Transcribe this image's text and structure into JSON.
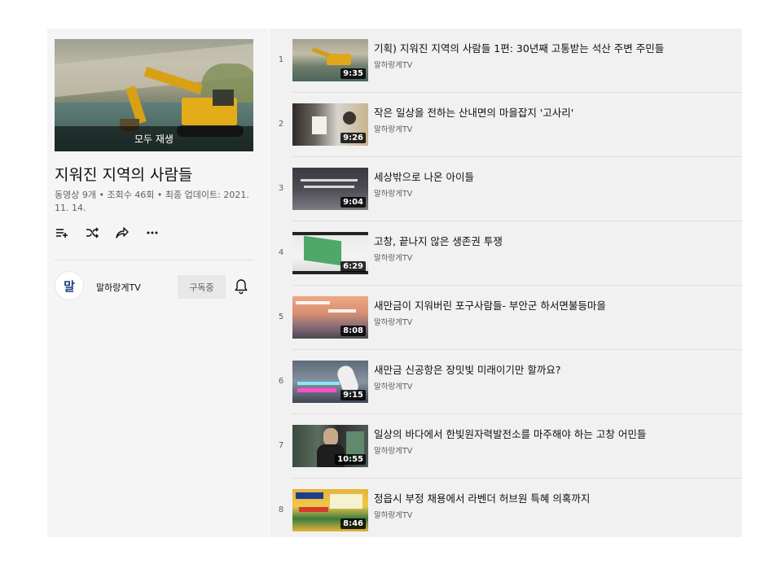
{
  "playlist": {
    "play_all_label": "모두 재생",
    "title": "지워진 지역의 사람들",
    "meta_line1": "동영상 9개 • 조회수 46회 • 최종 업데이트: 2021.",
    "meta_line2": "11. 14.",
    "owner": {
      "avatar_text": "말",
      "name": "말하랑게TV",
      "subscribe_label": "구독중"
    }
  },
  "icons": {
    "add_to_queue": "add-to-queue-icon",
    "shuffle": "shuffle-icon",
    "share": "share-icon",
    "more": "more-icon",
    "bell": "bell-icon"
  },
  "videos": [
    {
      "index": "1",
      "title": "기획) 지워진 지역의 사람들 1편: 30년째 고통받는 석산 주변 주민들",
      "channel": "말하랑게TV",
      "duration": "9:35"
    },
    {
      "index": "2",
      "title": "작은 일상을 전하는 산내면의 마을잡지 '고사리'",
      "channel": "말하랑게TV",
      "duration": "9:26"
    },
    {
      "index": "3",
      "title": "세상밖으로 나온 아이들",
      "channel": "말하랑게TV",
      "duration": "9:04"
    },
    {
      "index": "4",
      "title": "고창, 끝나지 않은 생존권 투쟁",
      "channel": "말하랑게TV",
      "duration": "6:29"
    },
    {
      "index": "5",
      "title": "새만금이 지워버린 포구사람들- 부안군 하서면불등마을",
      "channel": "말하랑게TV",
      "duration": "8:08"
    },
    {
      "index": "6",
      "title": "새만금 신공항은 장밋빛 미래이기만 할까요?",
      "channel": "말하랑게TV",
      "duration": "9:15"
    },
    {
      "index": "7",
      "title": "일상의 바다에서 한빛원자력발전소를 마주해야 하는 고창 어민들",
      "channel": "말하랑게TV",
      "duration": "10:55"
    },
    {
      "index": "8",
      "title": "정읍시 부정 채용에서 라벤더 허브원 특혜 의혹까지",
      "channel": "말하랑게TV",
      "duration": "8:46"
    }
  ]
}
